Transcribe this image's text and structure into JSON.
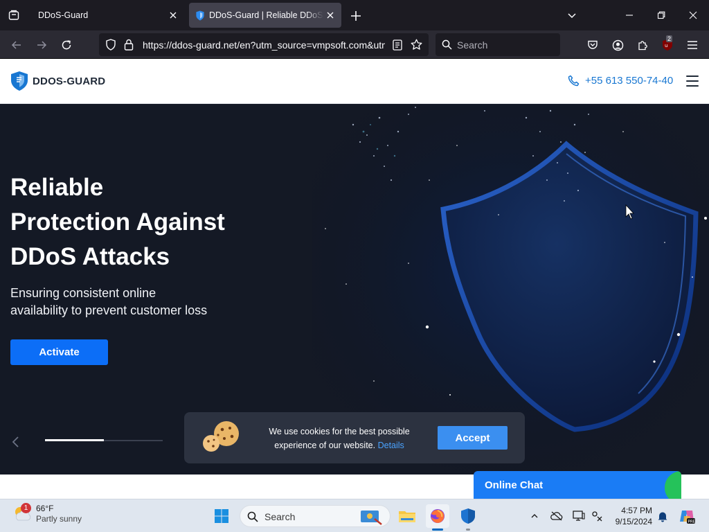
{
  "browser": {
    "tabs": [
      {
        "title": "DDoS-Guard",
        "active": false
      },
      {
        "title": "DDoS-Guard | Reliable DDoS Protection",
        "active": true
      }
    ],
    "url": "https://ddos-guard.net/en?utm_source=vmpsoft.com&utm_medium=referral",
    "search_placeholder": "Search",
    "extension_badge": "2"
  },
  "site": {
    "logo_text": "DDOS-GUARD",
    "phone": "+55 613 550-74-40"
  },
  "hero": {
    "title_lines": [
      "Reliable",
      "Protection Against",
      "DDoS Attacks"
    ],
    "subtitle_lines": [
      "Ensuring consistent online",
      "availability to prevent customer loss"
    ],
    "cta_label": "Activate",
    "slide_progress": 0.5
  },
  "cookie": {
    "text_line1": "We use cookies for the best possible",
    "text_line2": "experience of our website.",
    "link": "Details",
    "accept_label": "Accept"
  },
  "chat": {
    "label": "Online Chat"
  },
  "taskbar": {
    "weather_temp": "66°F",
    "weather_desc": "Partly sunny",
    "weather_badge": "1",
    "search_placeholder": "Search",
    "time": "4:57 PM",
    "date": "9/15/2024"
  },
  "colors": {
    "brand_blue": "#1877d2",
    "cta_blue": "#0c6ef7",
    "hero_bg": "#151a26",
    "chat_blue": "#1a7cf5"
  }
}
